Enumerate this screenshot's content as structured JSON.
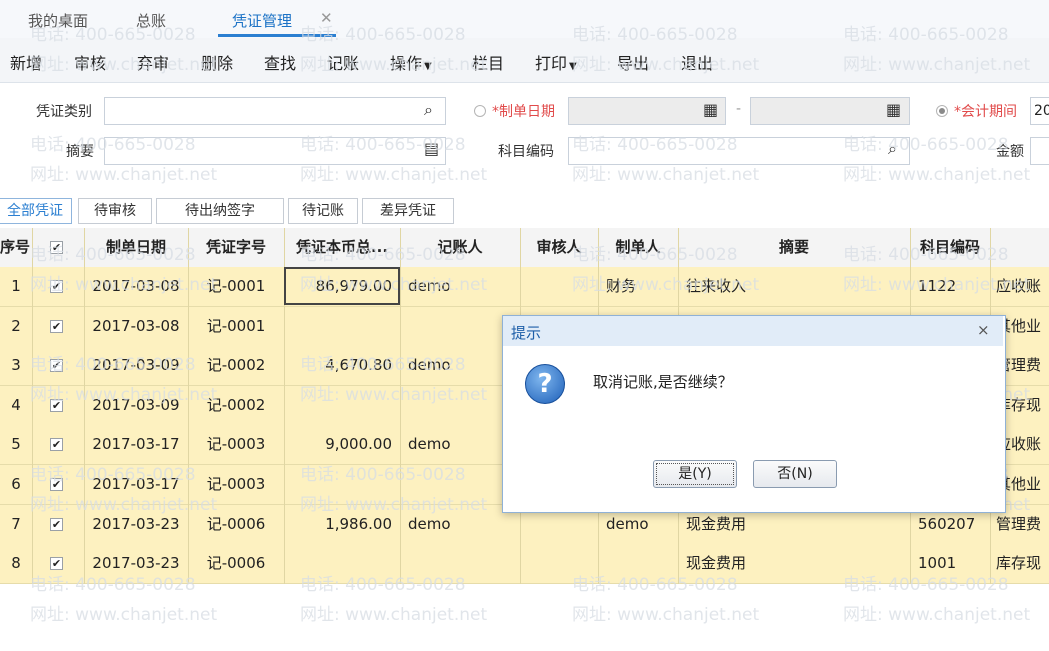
{
  "tabs": [
    {
      "label": "我的桌面"
    },
    {
      "label": "总账"
    },
    {
      "label": "凭证管理",
      "active": true
    }
  ],
  "tab_close_glyph": "✕",
  "toolbar": {
    "items": [
      "新增",
      "审核",
      "弃审",
      "删除",
      "查找",
      "记账",
      "操作",
      "栏目",
      "打印",
      "导出",
      "退出"
    ]
  },
  "filter": {
    "voucher_type_label": "凭证类别",
    "summary_label": "摘要",
    "date_label": "*制单日期",
    "date_sep": "-",
    "account_code_label": "科目编码",
    "period_label": "*会计期间",
    "period_value": "20",
    "amount_label": "金额"
  },
  "status_tabs": [
    "全部凭证",
    "待审核",
    "待出纳签字",
    "待记账",
    "差异凭证"
  ],
  "table": {
    "headers": [
      "序号",
      "",
      "制单日期",
      "凭证字号",
      "凭证本币总...",
      "记账人",
      "审核人",
      "制单人",
      "摘要",
      "科目编码",
      ""
    ],
    "rows": [
      {
        "no": "1",
        "date": "2017-03-08",
        "voucher": "记-0001",
        "amount": "86,979.00",
        "poster": "demo",
        "auditor": "",
        "maker": "财务",
        "summary": "往来收入",
        "code": "1122",
        "acct": "应收账"
      },
      {
        "no": "2",
        "date": "2017-03-08",
        "voucher": "记-0001",
        "amount": "",
        "poster": "",
        "auditor": "",
        "maker": "",
        "summary": "",
        "code": "",
        "acct": "其他业"
      },
      {
        "no": "3",
        "date": "2017-03-09",
        "voucher": "记-0002",
        "amount": "4,670.80",
        "poster": "demo",
        "auditor": "",
        "maker": "",
        "summary": "",
        "code": "",
        "acct": "管理费"
      },
      {
        "no": "4",
        "date": "2017-03-09",
        "voucher": "记-0002",
        "amount": "",
        "poster": "",
        "auditor": "",
        "maker": "",
        "summary": "",
        "code": "",
        "acct": "库存现"
      },
      {
        "no": "5",
        "date": "2017-03-17",
        "voucher": "记-0003",
        "amount": "9,000.00",
        "poster": "demo",
        "auditor": "",
        "maker": "",
        "summary": "",
        "code": "",
        "acct": "应收账"
      },
      {
        "no": "6",
        "date": "2017-03-17",
        "voucher": "记-0003",
        "amount": "",
        "poster": "",
        "auditor": "",
        "maker": "",
        "summary": "",
        "code": "",
        "acct": "其他业"
      },
      {
        "no": "7",
        "date": "2017-03-23",
        "voucher": "记-0006",
        "amount": "1,986.00",
        "poster": "demo",
        "auditor": "",
        "maker": "demo",
        "summary": "现金费用",
        "code": "560207",
        "acct": "管理费"
      },
      {
        "no": "8",
        "date": "2017-03-23",
        "voucher": "记-0006",
        "amount": "",
        "poster": "",
        "auditor": "",
        "maker": "",
        "summary": "现金费用",
        "code": "1001",
        "acct": "库存现"
      }
    ]
  },
  "watermark": {
    "phone": "电话: 400-665-0028",
    "site": "网址: www.chanjet.net"
  },
  "dialog": {
    "title": "提示",
    "close": "×",
    "icon": "?",
    "message": "取消记账,是否继续？",
    "yes": "是(Y)",
    "no": "否(N)"
  },
  "colors": {
    "accent": "#2b7fd1",
    "row_fill": "#fdf1c0",
    "dialog_title_bg": "#e1ecf8"
  }
}
